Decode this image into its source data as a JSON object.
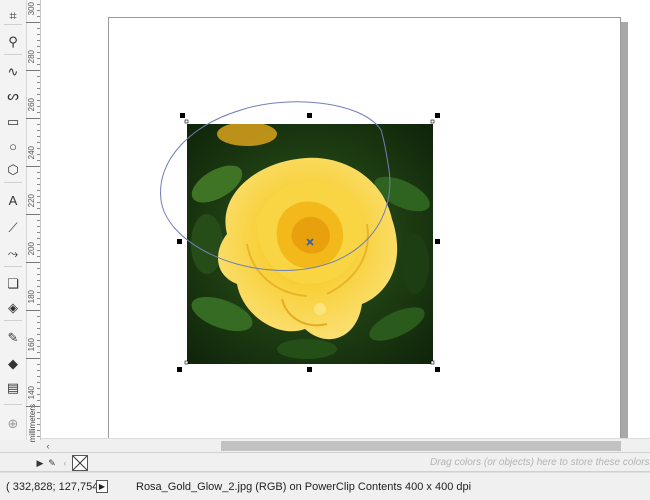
{
  "toolbox": {
    "tools": [
      {
        "name": "crop-tool-icon",
        "glyph": "⌗"
      },
      {
        "name": "zoom-tool-icon",
        "glyph": "⚲"
      },
      {
        "name": "freehand-tool-icon",
        "glyph": "∿"
      },
      {
        "name": "artistic-media-tool-icon",
        "glyph": "ᔕ"
      },
      {
        "name": "rectangle-tool-icon",
        "glyph": "▭"
      },
      {
        "name": "ellipse-tool-icon",
        "glyph": "○"
      },
      {
        "name": "polygon-tool-icon",
        "glyph": "⬡"
      },
      {
        "name": "text-tool-icon",
        "glyph": "A"
      },
      {
        "name": "parallel-dimension-tool-icon",
        "glyph": "⟋"
      },
      {
        "name": "connector-tool-icon",
        "glyph": "⤳"
      },
      {
        "name": "drop-shadow-tool-icon",
        "glyph": "❏"
      },
      {
        "name": "transparency-tool-icon",
        "glyph": "◈"
      },
      {
        "name": "eyedropper-tool-icon",
        "glyph": "✎"
      },
      {
        "name": "interactive-fill-tool-icon",
        "glyph": "◆"
      },
      {
        "name": "smart-fill-tool-icon",
        "glyph": "▤"
      },
      {
        "name": "add-tool-icon",
        "glyph": "⊕"
      }
    ]
  },
  "ruler": {
    "units": "millimeters",
    "labels": [
      "300",
      "280",
      "260",
      "240",
      "220",
      "200",
      "180",
      "160",
      "140"
    ]
  },
  "palette": {
    "hint": "Drag colors (or objects) here to store these colors w"
  },
  "status": {
    "coords": "( 332,828; 127,754 )",
    "info": "Rosa_Gold_Glow_2.jpg (RGB) on PowerClip Contents 400 x 400 dpi"
  },
  "colors": {
    "accent": "#2b5fb4",
    "ellipse": "#6f7fb8",
    "rose_yellow": "#f6cf2e",
    "foliage": "#1f3d16"
  }
}
